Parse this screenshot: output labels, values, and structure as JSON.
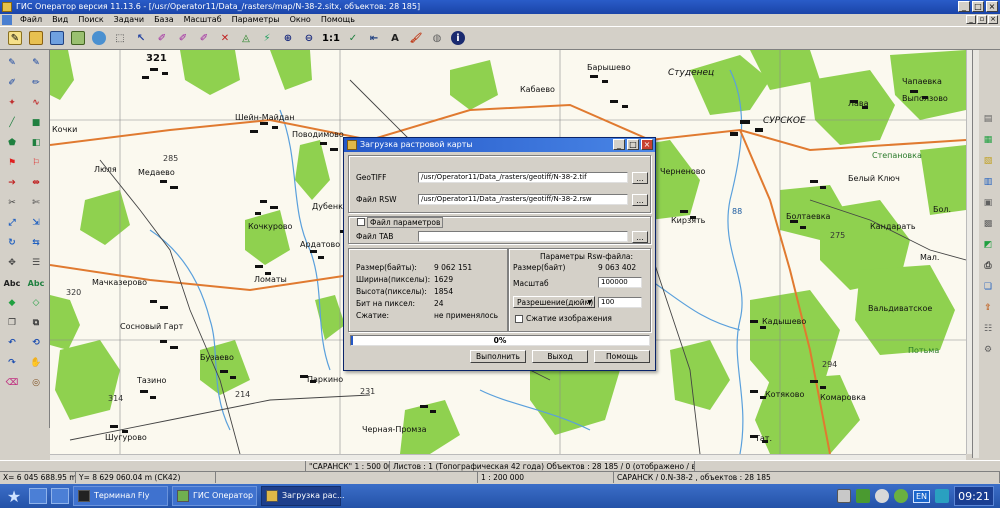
{
  "window": {
    "title": "ГИС Оператор версия 11.13.6 - [/usr/Operator11/Data_/rasters/map/N-38-2.sitx, объектов: 28 185]"
  },
  "menu": {
    "items": [
      "Файл",
      "Вид",
      "Поиск",
      "Задачи",
      "База",
      "Масштаб",
      "Параметры",
      "Окно",
      "Помощь"
    ]
  },
  "toolbar": {
    "scale_label": "1:1",
    "info_label": "i"
  },
  "lefttools": {
    "abc1": "Abc",
    "abc2": "Abc"
  },
  "map": {
    "labels": [
      {
        "text": "321"
      },
      {
        "text": "Барышево"
      },
      {
        "text": "Кабаево"
      },
      {
        "text": "Студенец"
      },
      {
        "text": "Лава"
      },
      {
        "text": "Выползово"
      },
      {
        "text": "Шейн-Майдан"
      },
      {
        "text": "Поводимово"
      },
      {
        "text": "СУРСКОЕ"
      },
      {
        "text": "Степановка"
      },
      {
        "text": "Кочки"
      },
      {
        "text": "Люля"
      },
      {
        "text": "Медаево"
      },
      {
        "text": "285"
      },
      {
        "text": "Белый Ключ"
      },
      {
        "text": "Черненово"
      },
      {
        "text": "Дубенки"
      },
      {
        "text": "Кочкурово"
      },
      {
        "text": "Ардатово"
      },
      {
        "text": "Кирзять"
      },
      {
        "text": "Болтаевка"
      },
      {
        "text": "Бол."
      },
      {
        "text": "Кандарать"
      },
      {
        "text": "275"
      },
      {
        "text": "Мал."
      },
      {
        "text": "Ломаты"
      },
      {
        "text": "Мачказерово"
      },
      {
        "text": "320"
      },
      {
        "text": "Кадышево"
      },
      {
        "text": "Вальдиватское"
      },
      {
        "text": "Сосновый Гарт"
      },
      {
        "text": "Бузаево"
      },
      {
        "text": "Паркино"
      },
      {
        "text": "294"
      },
      {
        "text": "Тазино"
      },
      {
        "text": "314"
      },
      {
        "text": "214"
      },
      {
        "text": "231"
      },
      {
        "text": "Котяково"
      },
      {
        "text": "Комаровка"
      },
      {
        "text": "Шугурово"
      },
      {
        "text": "Черная-Промза"
      },
      {
        "text": "Тат."
      },
      {
        "text": "88"
      },
      {
        "text": "Чапаевка"
      },
      {
        "text": "Потьма"
      }
    ]
  },
  "dialog": {
    "title": "Загрузка растровой карты",
    "geotiff_label": "GeoTIFF",
    "geotiff_value": "/usr/Operator11/Data_/rasters/geotiff/N-38-2.tif",
    "rsw_label": "Файл RSW",
    "rsw_value": "/usr/Operator11/Data_/rasters/geotiff/N-38-2.rsw",
    "params_file_label": "Файл параметров",
    "tab_label": "Файл TAB",
    "tab_value": "",
    "browse_label": "...",
    "left_info": [
      {
        "label": "Размер(байты):",
        "value": "9 062 151"
      },
      {
        "label": "Ширина(пикселы):",
        "value": "1629"
      },
      {
        "label": "Высота(пикселы):",
        "value": "1854"
      },
      {
        "label": "Бит на пиксел:",
        "value": "24"
      },
      {
        "label": "Сжатие:",
        "value": "не применялось"
      }
    ],
    "rsw_params_title": "Параметры Rsw-файла:",
    "rsw_size_label": "Размер(байт)",
    "rsw_size_value": "9 063 402",
    "scale_label": "Масштаб",
    "scale_value": "100000",
    "resolution_select": "Разрешение(дюйм)",
    "resolution_value": "100",
    "compress_label": "Сжатие изображения",
    "progress_text": "0%",
    "progress_fraction": 0.0,
    "btn_execute": "Выполнить",
    "btn_exit": "Выход",
    "btn_help": "Помощь"
  },
  "status": {
    "line1": {
      "region": "\"САРАНСК\"  1 : 500 000",
      "sheets": "Листов : 1  (Топографическая 42 года)  Объектов : 28 185 / 0 (отображено / выделено)"
    },
    "line2": {
      "x": "X= 6 045 688.95 m",
      "y": "Y= 8 629 060.04 m  (СК42)",
      "scale": "1 : 200 000",
      "sheet": "САРАНСК / 0.N-38-2 ,  объектов : 28 185"
    }
  },
  "taskbar": {
    "tasks": [
      "Терминал Fly",
      "ГИС Оператор",
      "Загрузка рас..."
    ],
    "lang": "EN",
    "time": "09:21"
  }
}
